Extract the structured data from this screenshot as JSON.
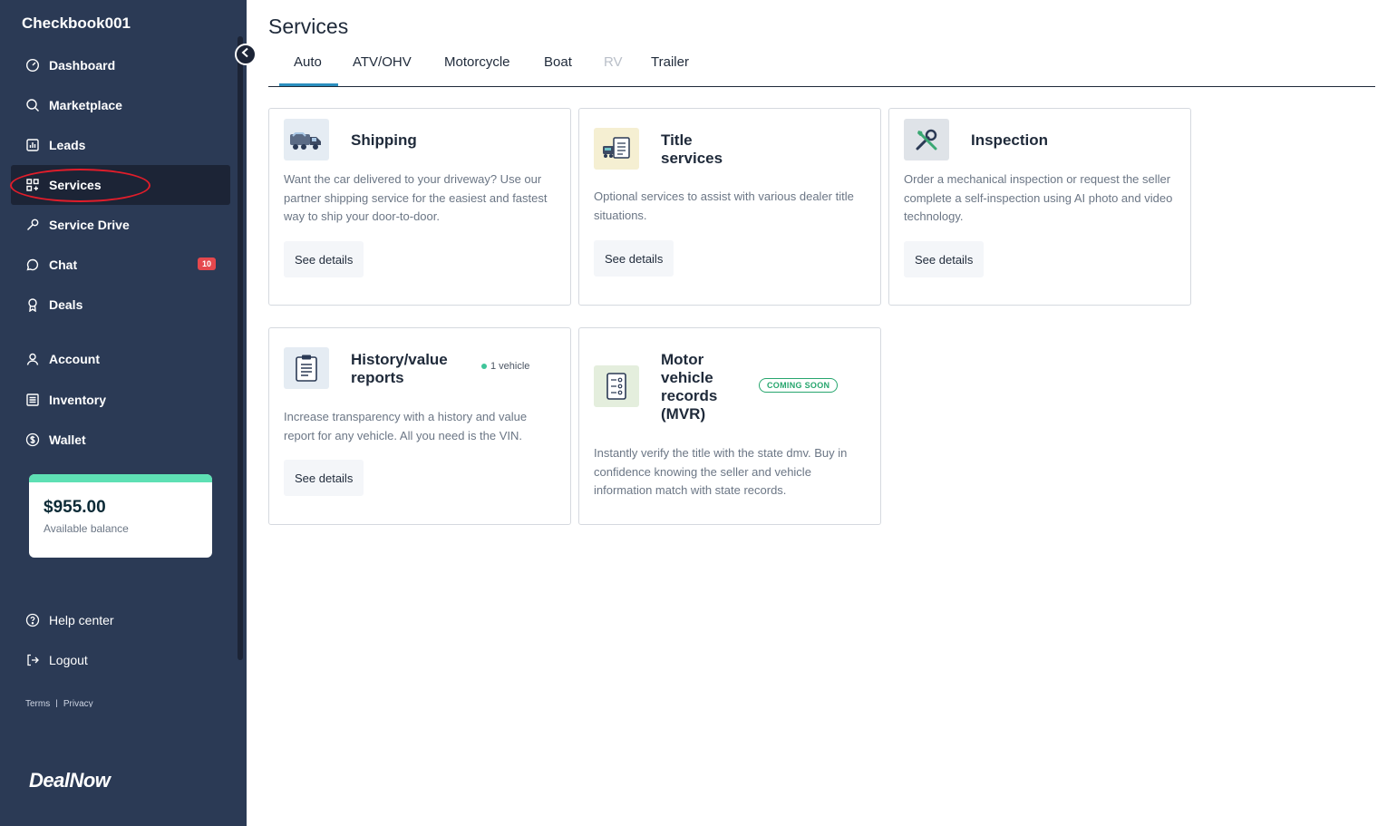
{
  "sidebar": {
    "brand": "Checkbook001",
    "items": [
      {
        "label": "Dashboard",
        "icon": "dashboard-icon"
      },
      {
        "label": "Marketplace",
        "icon": "search-icon"
      },
      {
        "label": "Leads",
        "icon": "chart-icon"
      },
      {
        "label": "Services",
        "icon": "grid-plus-icon"
      },
      {
        "label": "Service Drive",
        "icon": "wrench-icon"
      },
      {
        "label": "Chat",
        "icon": "chat-icon",
        "badge": "10"
      },
      {
        "label": "Deals",
        "icon": "ribbon-icon"
      },
      {
        "label": "Account",
        "icon": "user-icon"
      },
      {
        "label": "Inventory",
        "icon": "list-icon"
      },
      {
        "label": "Wallet",
        "icon": "dollar-icon"
      }
    ],
    "balance": {
      "amount": "$955.00",
      "label": "Available balance"
    },
    "footer_items": [
      {
        "label": "Help center",
        "icon": "help-icon"
      },
      {
        "label": "Logout",
        "icon": "logout-icon"
      }
    ],
    "legal": {
      "terms": "Terms",
      "separator": "|",
      "privacy": "Privacy"
    },
    "logo": "DealNow"
  },
  "main": {
    "title": "Services",
    "tabs": [
      {
        "label": "Auto",
        "active": true
      },
      {
        "label": "ATV/OHV"
      },
      {
        "label": "Motorcycle"
      },
      {
        "label": "Boat"
      },
      {
        "label": "RV",
        "disabled": true
      },
      {
        "label": "Trailer"
      }
    ],
    "cards": [
      {
        "title": "Shipping",
        "description": "Want the car delivered to your driveway? Use our partner shipping service for the easiest and fastest way to ship your door-to-door.",
        "button": "See details",
        "icon": "truck-icon"
      },
      {
        "title": "Title services",
        "description": "Optional services to assist with various dealer title situations.",
        "button": "See details",
        "icon": "vehicle-document-icon"
      },
      {
        "title": "Inspection",
        "description": "Order a mechanical inspection or request the seller complete a self-inspection using AI photo and video technology.",
        "button": "See details",
        "icon": "tools-icon"
      },
      {
        "title": "History/value reports",
        "tag": "1 vehicle",
        "description": "Increase transparency with a history and value report for any vehicle. All you need is the VIN.",
        "button": "See details",
        "icon": "clipboard-icon"
      },
      {
        "title": "Motor vehicle records (MVR)",
        "badge": "COMING SOON",
        "description": "Instantly verify the title with the state dmv. Buy in confidence knowing the seller and vehicle information match with state records.",
        "icon": "checklist-icon"
      }
    ]
  },
  "colors": {
    "sidebar_bg": "#2b3a55",
    "active_bg": "#1c2436",
    "accent": "#2b8fbf",
    "balance_accent": "#5ee0b4",
    "badge": "#e5484d",
    "coming_soon": "#27a66e",
    "annotation_ring": "#e11d2a"
  }
}
